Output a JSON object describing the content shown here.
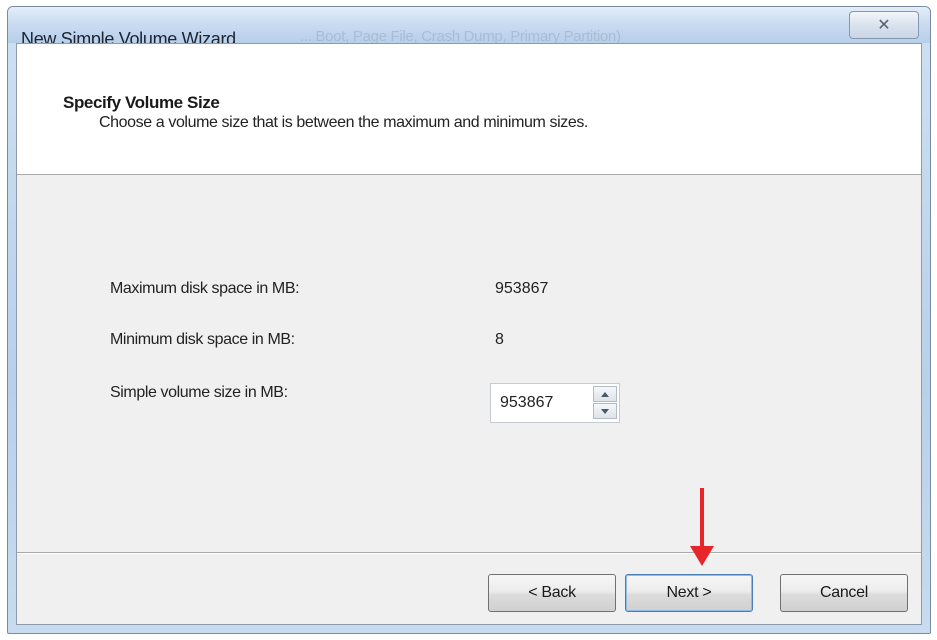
{
  "window": {
    "title": "New Simple Volume Wizard",
    "background_title": "... Boot, Page File, Crash Dump, Primary Partition)",
    "close_glyph": "✕"
  },
  "header": {
    "title": "Specify Volume Size",
    "subtitle": "Choose a volume size that is between the maximum and minimum sizes."
  },
  "fields": {
    "max_label": "Maximum disk space in MB:",
    "max_value": "953867",
    "min_label": "Minimum disk space in MB:",
    "min_value": "8",
    "size_label": "Simple volume size in MB:",
    "size_value": "953867"
  },
  "buttons": {
    "back": "< Back",
    "next": "Next >",
    "cancel": "Cancel"
  },
  "icons": {
    "spin_up": "up-arrow-icon",
    "spin_down": "down-arrow-icon",
    "annotation": "red-arrow-icon"
  },
  "colors": {
    "annotation_arrow": "#e8262a",
    "header_bg": "#ffffff",
    "dialog_bg": "#f0f0f0"
  }
}
